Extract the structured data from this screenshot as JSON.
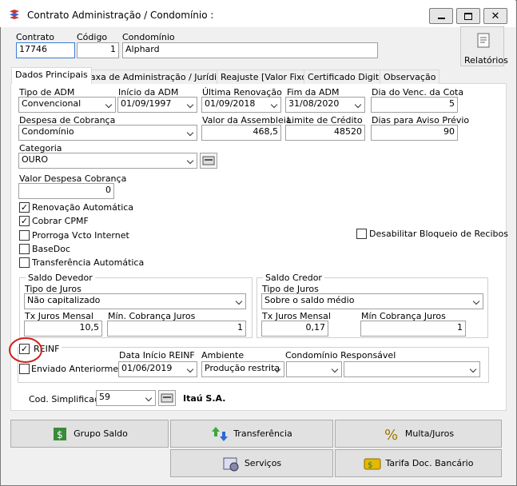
{
  "window": {
    "title": "Contrato Administração / Condomínio :"
  },
  "header": {
    "contrato_label": "Contrato",
    "contrato_value": "17746",
    "codigo_label": "Código",
    "codigo_value": "1",
    "condominio_label": "Condomínio",
    "condominio_value": "Alphard",
    "relatorios_label": "Relatórios"
  },
  "tabs": [
    "Dados Principais",
    "Taxa de Administração / Jurídico",
    "Reajuste [Valor Fixo]",
    "Certificado Digital",
    "Observação"
  ],
  "form": {
    "tipo_adm_label": "Tipo de ADM",
    "tipo_adm_value": "Convencional",
    "inicio_adm_label": "Início da ADM",
    "inicio_adm_value": "01/09/1997",
    "ultima_renov_label": "Última Renovação",
    "ultima_renov_value": "01/09/2018",
    "fim_adm_label": "Fim da ADM",
    "fim_adm_value": "31/08/2020",
    "dia_venc_label": "Dia do Venc. da Cota",
    "dia_venc_value": "5",
    "despesa_cob_label": "Despesa de Cobrança",
    "despesa_cob_value": "Condomínio",
    "valor_assembleia_label": "Valor da Assembleia",
    "valor_assembleia_value": "468,5",
    "limite_credito_label": "Limite de Crédito",
    "limite_credito_value": "48520",
    "dias_aviso_label": "Dias para Aviso Prévio",
    "dias_aviso_value": "90",
    "categoria_label": "Categoria",
    "categoria_value": "OURO",
    "valor_desp_cob_label": "Valor Despesa Cobrança",
    "valor_desp_cob_value": "0",
    "renovacao_auto": "Renovação Automática",
    "cobrar_cpmf": "Cobrar CPMF",
    "prorroga": "Prorroga Vcto Internet",
    "basedoc": "BaseDoc",
    "transf_auto": "Transferência Automática",
    "desabilitar_bloqueio": "Desabilitar Bloqueio de Recibos"
  },
  "saldo_devedor": {
    "title": "Saldo Devedor",
    "tipo_juros_label": "Tipo de Juros",
    "tipo_juros_value": "Não capitalizado",
    "tx_juros_label": "Tx Juros Mensal",
    "tx_juros_value": "10,5",
    "min_cob_label": "Mín. Cobrança Juros",
    "min_cob_value": "1"
  },
  "saldo_credor": {
    "title": "Saldo Credor",
    "tipo_juros_label": "Tipo de Juros",
    "tipo_juros_value": "Sobre o saldo médio",
    "tx_juros_label": "Tx Juros Mensal",
    "tx_juros_value": "0,17",
    "min_cob_label": "Mín Cobrança Juros",
    "min_cob_value": "1"
  },
  "reinf": {
    "label": "REINF",
    "enviado_label": "Enviado Anteriormente",
    "data_inicio_label": "Data Início REINF",
    "data_inicio_value": "01/06/2019",
    "ambiente_label": "Ambiente",
    "ambiente_value": "Produção restrita",
    "cond_resp_label": "Condomínio Responsável",
    "cond_resp_value": ""
  },
  "cod_simplificado": {
    "label": "Cod. Simplificado",
    "value": "59",
    "bank": "Itaú S.A."
  },
  "buttons": {
    "grupo_saldo": "Grupo Saldo",
    "transferencia": "Transferência",
    "multa_juros": "Multa/Juros",
    "servicos": "Serviços",
    "tarifa": "Tarifa Doc. Bancário"
  },
  "colors": {
    "annotation_circle": "#d0201a",
    "focus_border": "#3a7bd5"
  }
}
